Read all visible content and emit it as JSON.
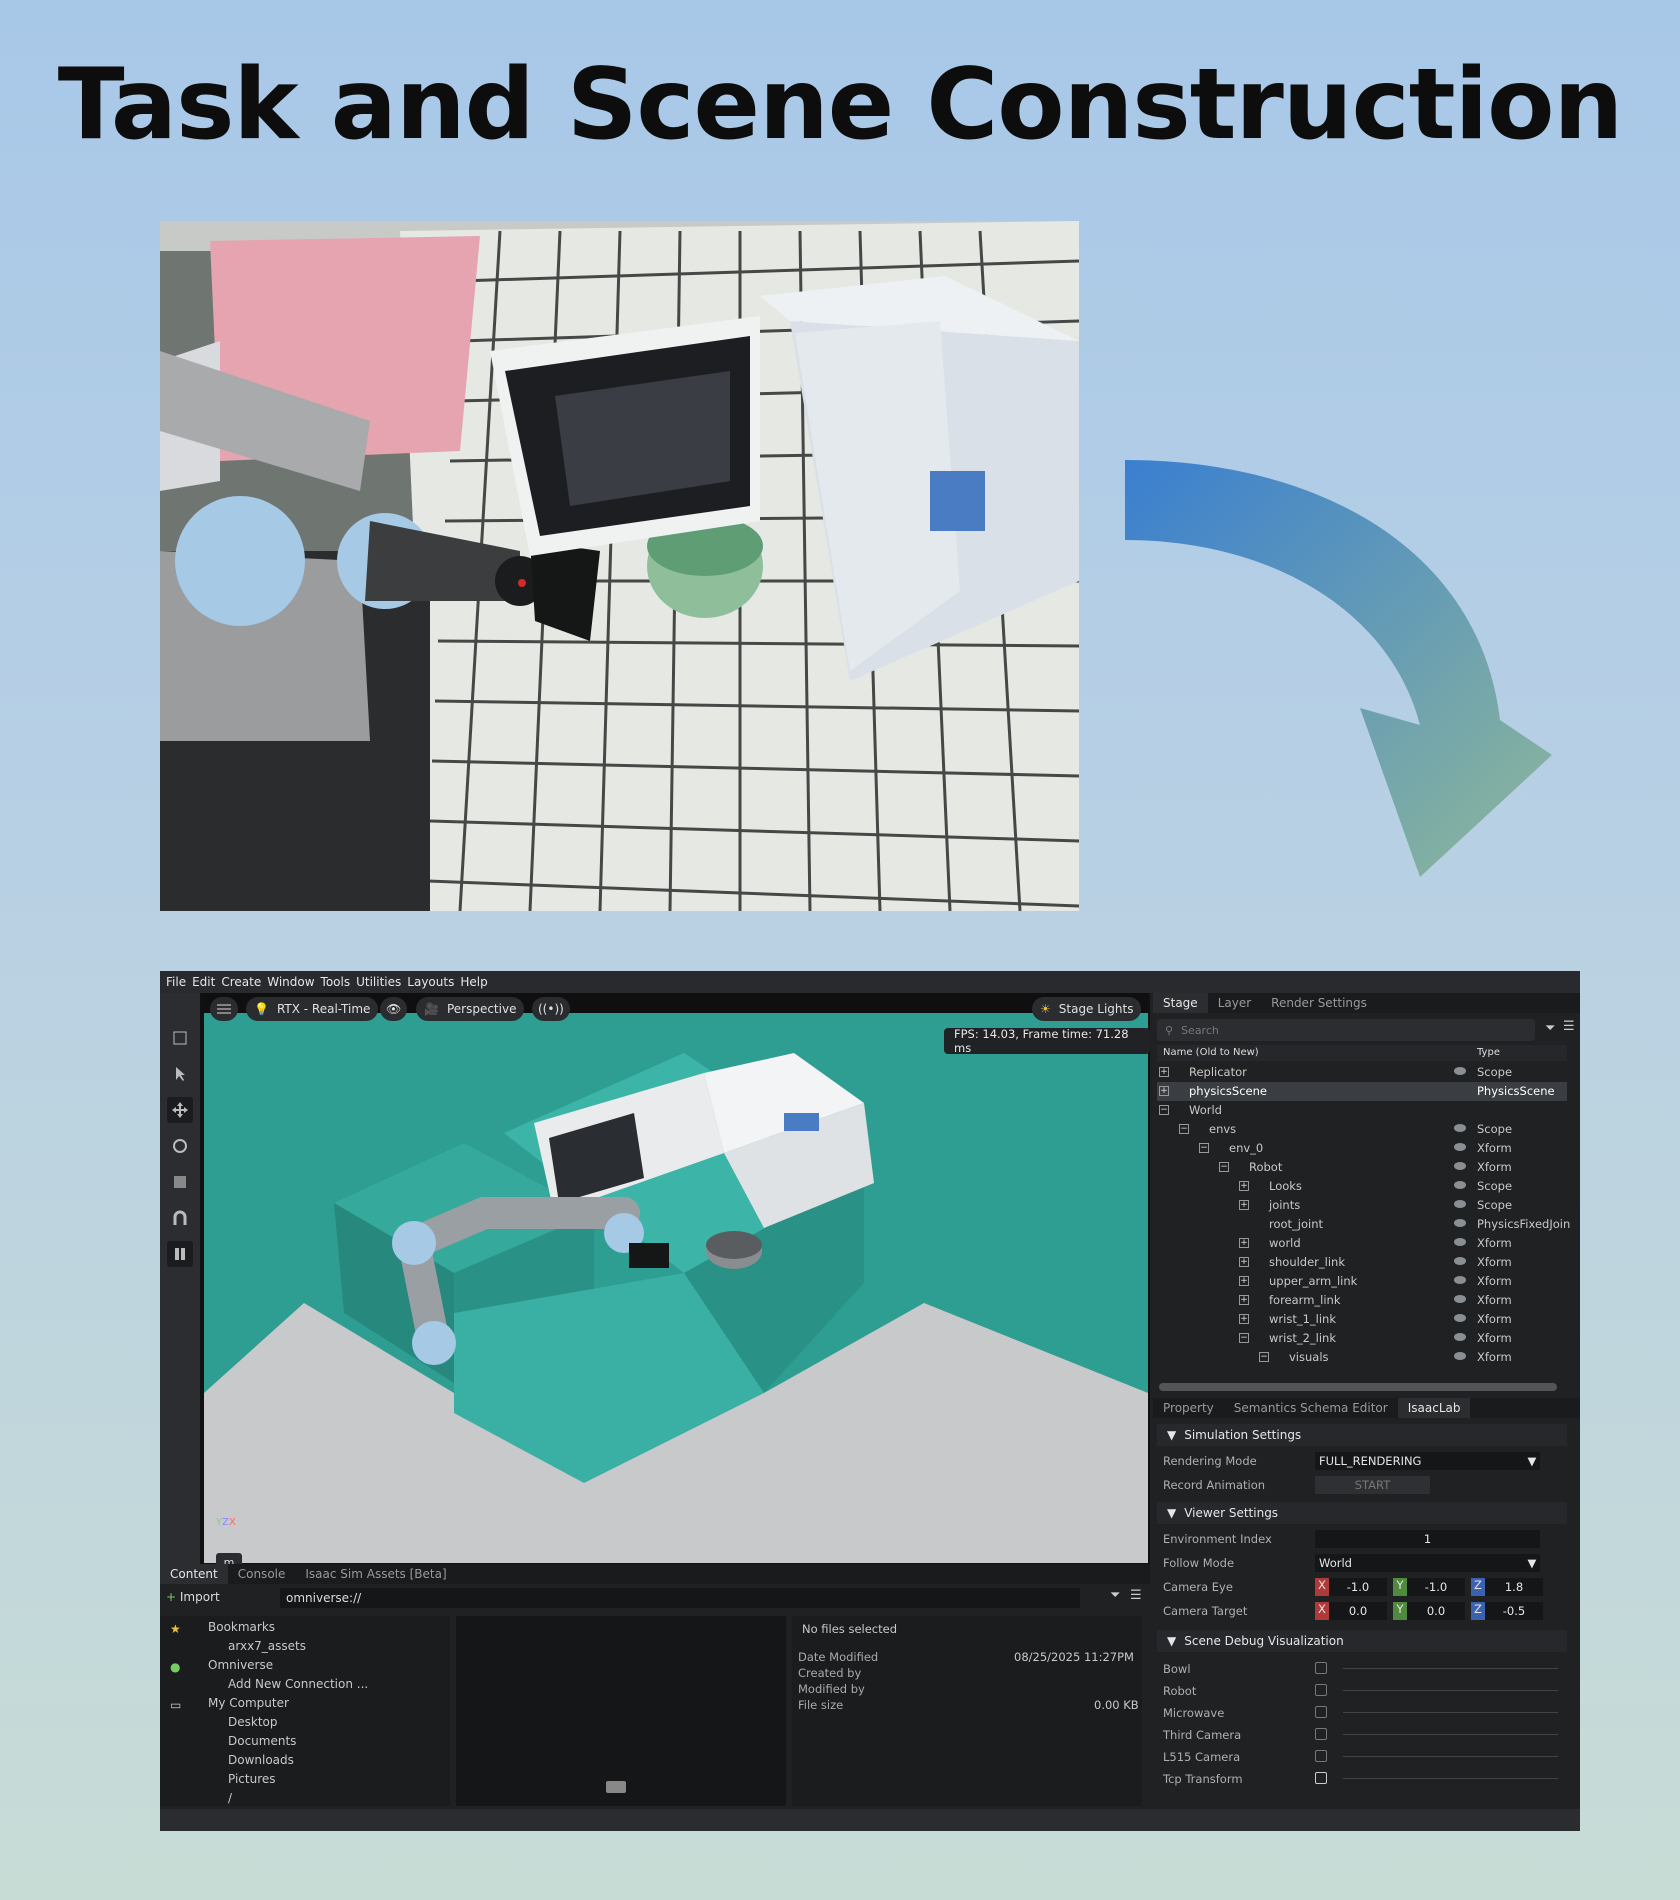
{
  "title": "Task and Scene Construction",
  "menu": [
    "File",
    "Edit",
    "Create",
    "Window",
    "Tools",
    "Utilities",
    "Layouts",
    "Help"
  ],
  "viewport": {
    "renderer_label": "RTX - Real-Time",
    "camera_label": "Perspective",
    "fps_text": "FPS: 14.03, Frame time: 71.28 ms",
    "stage_lights_label": "Stage Lights",
    "unit_badge": "m"
  },
  "stage": {
    "tabs": [
      "Stage",
      "Layer",
      "Render Settings"
    ],
    "search_placeholder": "Search",
    "col_name": "Name (Old to New)",
    "col_type": "Type",
    "rows": [
      {
        "name": "Replicator",
        "type": "Scope"
      },
      {
        "name": "physicsScene",
        "type": "PhysicsScene"
      },
      {
        "name": "World",
        "type": ""
      },
      {
        "name": "envs",
        "type": "Scope"
      },
      {
        "name": "env_0",
        "type": "Xform"
      },
      {
        "name": "Robot",
        "type": "Xform"
      },
      {
        "name": "Looks",
        "type": "Scope"
      },
      {
        "name": "joints",
        "type": "Scope"
      },
      {
        "name": "root_joint",
        "type": "PhysicsFixedJoin"
      },
      {
        "name": "world",
        "type": "Xform"
      },
      {
        "name": "shoulder_link",
        "type": "Xform"
      },
      {
        "name": "upper_arm_link",
        "type": "Xform"
      },
      {
        "name": "forearm_link",
        "type": "Xform"
      },
      {
        "name": "wrist_1_link",
        "type": "Xform"
      },
      {
        "name": "wrist_2_link",
        "type": "Xform"
      },
      {
        "name": "visuals",
        "type": "Xform"
      }
    ]
  },
  "property": {
    "tabs": [
      "Property",
      "Semantics Schema Editor",
      "IsaacLab"
    ],
    "simulation_settings": "Simulation Settings",
    "rendering_mode_label": "Rendering Mode",
    "rendering_mode_value": "FULL_RENDERING",
    "record_animation_label": "Record Animation",
    "record_button": "START",
    "viewer_settings": "Viewer Settings",
    "env_index_label": "Environment Index",
    "env_index_value": "1",
    "follow_mode_label": "Follow Mode",
    "follow_mode_value": "World",
    "camera_eye_label": "Camera Eye",
    "camera_eye": {
      "x": "-1.0",
      "y": "-1.0",
      "z": "1.8"
    },
    "camera_target_label": "Camera Target",
    "camera_target": {
      "x": "0.0",
      "y": "0.0",
      "z": "-0.5"
    },
    "axis_letters": {
      "x": "X",
      "y": "Y",
      "z": "Z"
    },
    "scene_debug": "Scene Debug Visualization",
    "debug_items": [
      "Bowl",
      "Robot",
      "Microwave",
      "Third Camera",
      "L515 Camera",
      "Tcp Transform"
    ]
  },
  "content": {
    "tabs": [
      "Content",
      "Console",
      "Isaac Sim Assets [Beta]"
    ],
    "import_label": "Import",
    "path": "omniverse://",
    "tree": [
      "Bookmarks",
      "arxx7_assets",
      "Omniverse",
      "Add New Connection ...",
      "My Computer",
      "Desktop",
      "Documents",
      "Downloads",
      "Pictures",
      "/"
    ],
    "no_files": "No files selected",
    "date_modified_label": "Date Modified",
    "date_modified_value": "08/25/2025 11:27PM",
    "created_by_label": "Created by",
    "modified_by_label": "Modified by",
    "file_size_label": "File size",
    "file_size_value": "0.00 KB"
  },
  "colors": {
    "teal": "#2f9e92",
    "arrow_start": "#3a7fd0",
    "arrow_end": "#8fb89a"
  }
}
